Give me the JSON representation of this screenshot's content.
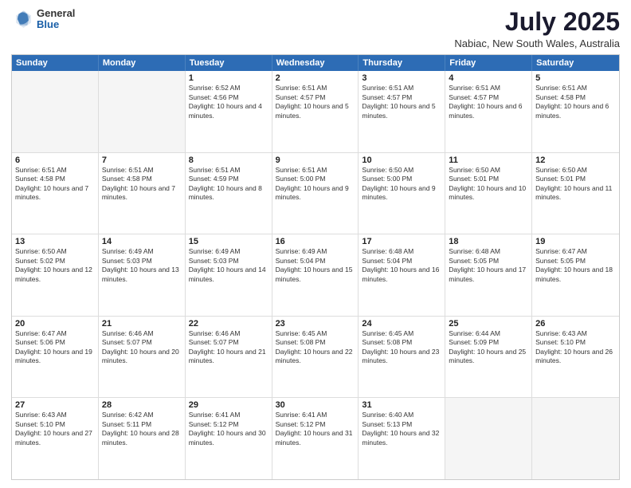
{
  "logo": {
    "general": "General",
    "blue": "Blue"
  },
  "title": "July 2025",
  "subtitle": "Nabiac, New South Wales, Australia",
  "header_days": [
    "Sunday",
    "Monday",
    "Tuesday",
    "Wednesday",
    "Thursday",
    "Friday",
    "Saturday"
  ],
  "weeks": [
    [
      {
        "day": "",
        "sunrise": "",
        "sunset": "",
        "daylight": ""
      },
      {
        "day": "",
        "sunrise": "",
        "sunset": "",
        "daylight": ""
      },
      {
        "day": "1",
        "sunrise": "Sunrise: 6:52 AM",
        "sunset": "Sunset: 4:56 PM",
        "daylight": "Daylight: 10 hours and 4 minutes."
      },
      {
        "day": "2",
        "sunrise": "Sunrise: 6:51 AM",
        "sunset": "Sunset: 4:57 PM",
        "daylight": "Daylight: 10 hours and 5 minutes."
      },
      {
        "day": "3",
        "sunrise": "Sunrise: 6:51 AM",
        "sunset": "Sunset: 4:57 PM",
        "daylight": "Daylight: 10 hours and 5 minutes."
      },
      {
        "day": "4",
        "sunrise": "Sunrise: 6:51 AM",
        "sunset": "Sunset: 4:57 PM",
        "daylight": "Daylight: 10 hours and 6 minutes."
      },
      {
        "day": "5",
        "sunrise": "Sunrise: 6:51 AM",
        "sunset": "Sunset: 4:58 PM",
        "daylight": "Daylight: 10 hours and 6 minutes."
      }
    ],
    [
      {
        "day": "6",
        "sunrise": "Sunrise: 6:51 AM",
        "sunset": "Sunset: 4:58 PM",
        "daylight": "Daylight: 10 hours and 7 minutes."
      },
      {
        "day": "7",
        "sunrise": "Sunrise: 6:51 AM",
        "sunset": "Sunset: 4:58 PM",
        "daylight": "Daylight: 10 hours and 7 minutes."
      },
      {
        "day": "8",
        "sunrise": "Sunrise: 6:51 AM",
        "sunset": "Sunset: 4:59 PM",
        "daylight": "Daylight: 10 hours and 8 minutes."
      },
      {
        "day": "9",
        "sunrise": "Sunrise: 6:51 AM",
        "sunset": "Sunset: 5:00 PM",
        "daylight": "Daylight: 10 hours and 9 minutes."
      },
      {
        "day": "10",
        "sunrise": "Sunrise: 6:50 AM",
        "sunset": "Sunset: 5:00 PM",
        "daylight": "Daylight: 10 hours and 9 minutes."
      },
      {
        "day": "11",
        "sunrise": "Sunrise: 6:50 AM",
        "sunset": "Sunset: 5:01 PM",
        "daylight": "Daylight: 10 hours and 10 minutes."
      },
      {
        "day": "12",
        "sunrise": "Sunrise: 6:50 AM",
        "sunset": "Sunset: 5:01 PM",
        "daylight": "Daylight: 10 hours and 11 minutes."
      }
    ],
    [
      {
        "day": "13",
        "sunrise": "Sunrise: 6:50 AM",
        "sunset": "Sunset: 5:02 PM",
        "daylight": "Daylight: 10 hours and 12 minutes."
      },
      {
        "day": "14",
        "sunrise": "Sunrise: 6:49 AM",
        "sunset": "Sunset: 5:03 PM",
        "daylight": "Daylight: 10 hours and 13 minutes."
      },
      {
        "day": "15",
        "sunrise": "Sunrise: 6:49 AM",
        "sunset": "Sunset: 5:03 PM",
        "daylight": "Daylight: 10 hours and 14 minutes."
      },
      {
        "day": "16",
        "sunrise": "Sunrise: 6:49 AM",
        "sunset": "Sunset: 5:04 PM",
        "daylight": "Daylight: 10 hours and 15 minutes."
      },
      {
        "day": "17",
        "sunrise": "Sunrise: 6:48 AM",
        "sunset": "Sunset: 5:04 PM",
        "daylight": "Daylight: 10 hours and 16 minutes."
      },
      {
        "day": "18",
        "sunrise": "Sunrise: 6:48 AM",
        "sunset": "Sunset: 5:05 PM",
        "daylight": "Daylight: 10 hours and 17 minutes."
      },
      {
        "day": "19",
        "sunrise": "Sunrise: 6:47 AM",
        "sunset": "Sunset: 5:05 PM",
        "daylight": "Daylight: 10 hours and 18 minutes."
      }
    ],
    [
      {
        "day": "20",
        "sunrise": "Sunrise: 6:47 AM",
        "sunset": "Sunset: 5:06 PM",
        "daylight": "Daylight: 10 hours and 19 minutes."
      },
      {
        "day": "21",
        "sunrise": "Sunrise: 6:46 AM",
        "sunset": "Sunset: 5:07 PM",
        "daylight": "Daylight: 10 hours and 20 minutes."
      },
      {
        "day": "22",
        "sunrise": "Sunrise: 6:46 AM",
        "sunset": "Sunset: 5:07 PM",
        "daylight": "Daylight: 10 hours and 21 minutes."
      },
      {
        "day": "23",
        "sunrise": "Sunrise: 6:45 AM",
        "sunset": "Sunset: 5:08 PM",
        "daylight": "Daylight: 10 hours and 22 minutes."
      },
      {
        "day": "24",
        "sunrise": "Sunrise: 6:45 AM",
        "sunset": "Sunset: 5:08 PM",
        "daylight": "Daylight: 10 hours and 23 minutes."
      },
      {
        "day": "25",
        "sunrise": "Sunrise: 6:44 AM",
        "sunset": "Sunset: 5:09 PM",
        "daylight": "Daylight: 10 hours and 25 minutes."
      },
      {
        "day": "26",
        "sunrise": "Sunrise: 6:43 AM",
        "sunset": "Sunset: 5:10 PM",
        "daylight": "Daylight: 10 hours and 26 minutes."
      }
    ],
    [
      {
        "day": "27",
        "sunrise": "Sunrise: 6:43 AM",
        "sunset": "Sunset: 5:10 PM",
        "daylight": "Daylight: 10 hours and 27 minutes."
      },
      {
        "day": "28",
        "sunrise": "Sunrise: 6:42 AM",
        "sunset": "Sunset: 5:11 PM",
        "daylight": "Daylight: 10 hours and 28 minutes."
      },
      {
        "day": "29",
        "sunrise": "Sunrise: 6:41 AM",
        "sunset": "Sunset: 5:12 PM",
        "daylight": "Daylight: 10 hours and 30 minutes."
      },
      {
        "day": "30",
        "sunrise": "Sunrise: 6:41 AM",
        "sunset": "Sunset: 5:12 PM",
        "daylight": "Daylight: 10 hours and 31 minutes."
      },
      {
        "day": "31",
        "sunrise": "Sunrise: 6:40 AM",
        "sunset": "Sunset: 5:13 PM",
        "daylight": "Daylight: 10 hours and 32 minutes."
      },
      {
        "day": "",
        "sunrise": "",
        "sunset": "",
        "daylight": ""
      },
      {
        "day": "",
        "sunrise": "",
        "sunset": "",
        "daylight": ""
      }
    ]
  ]
}
